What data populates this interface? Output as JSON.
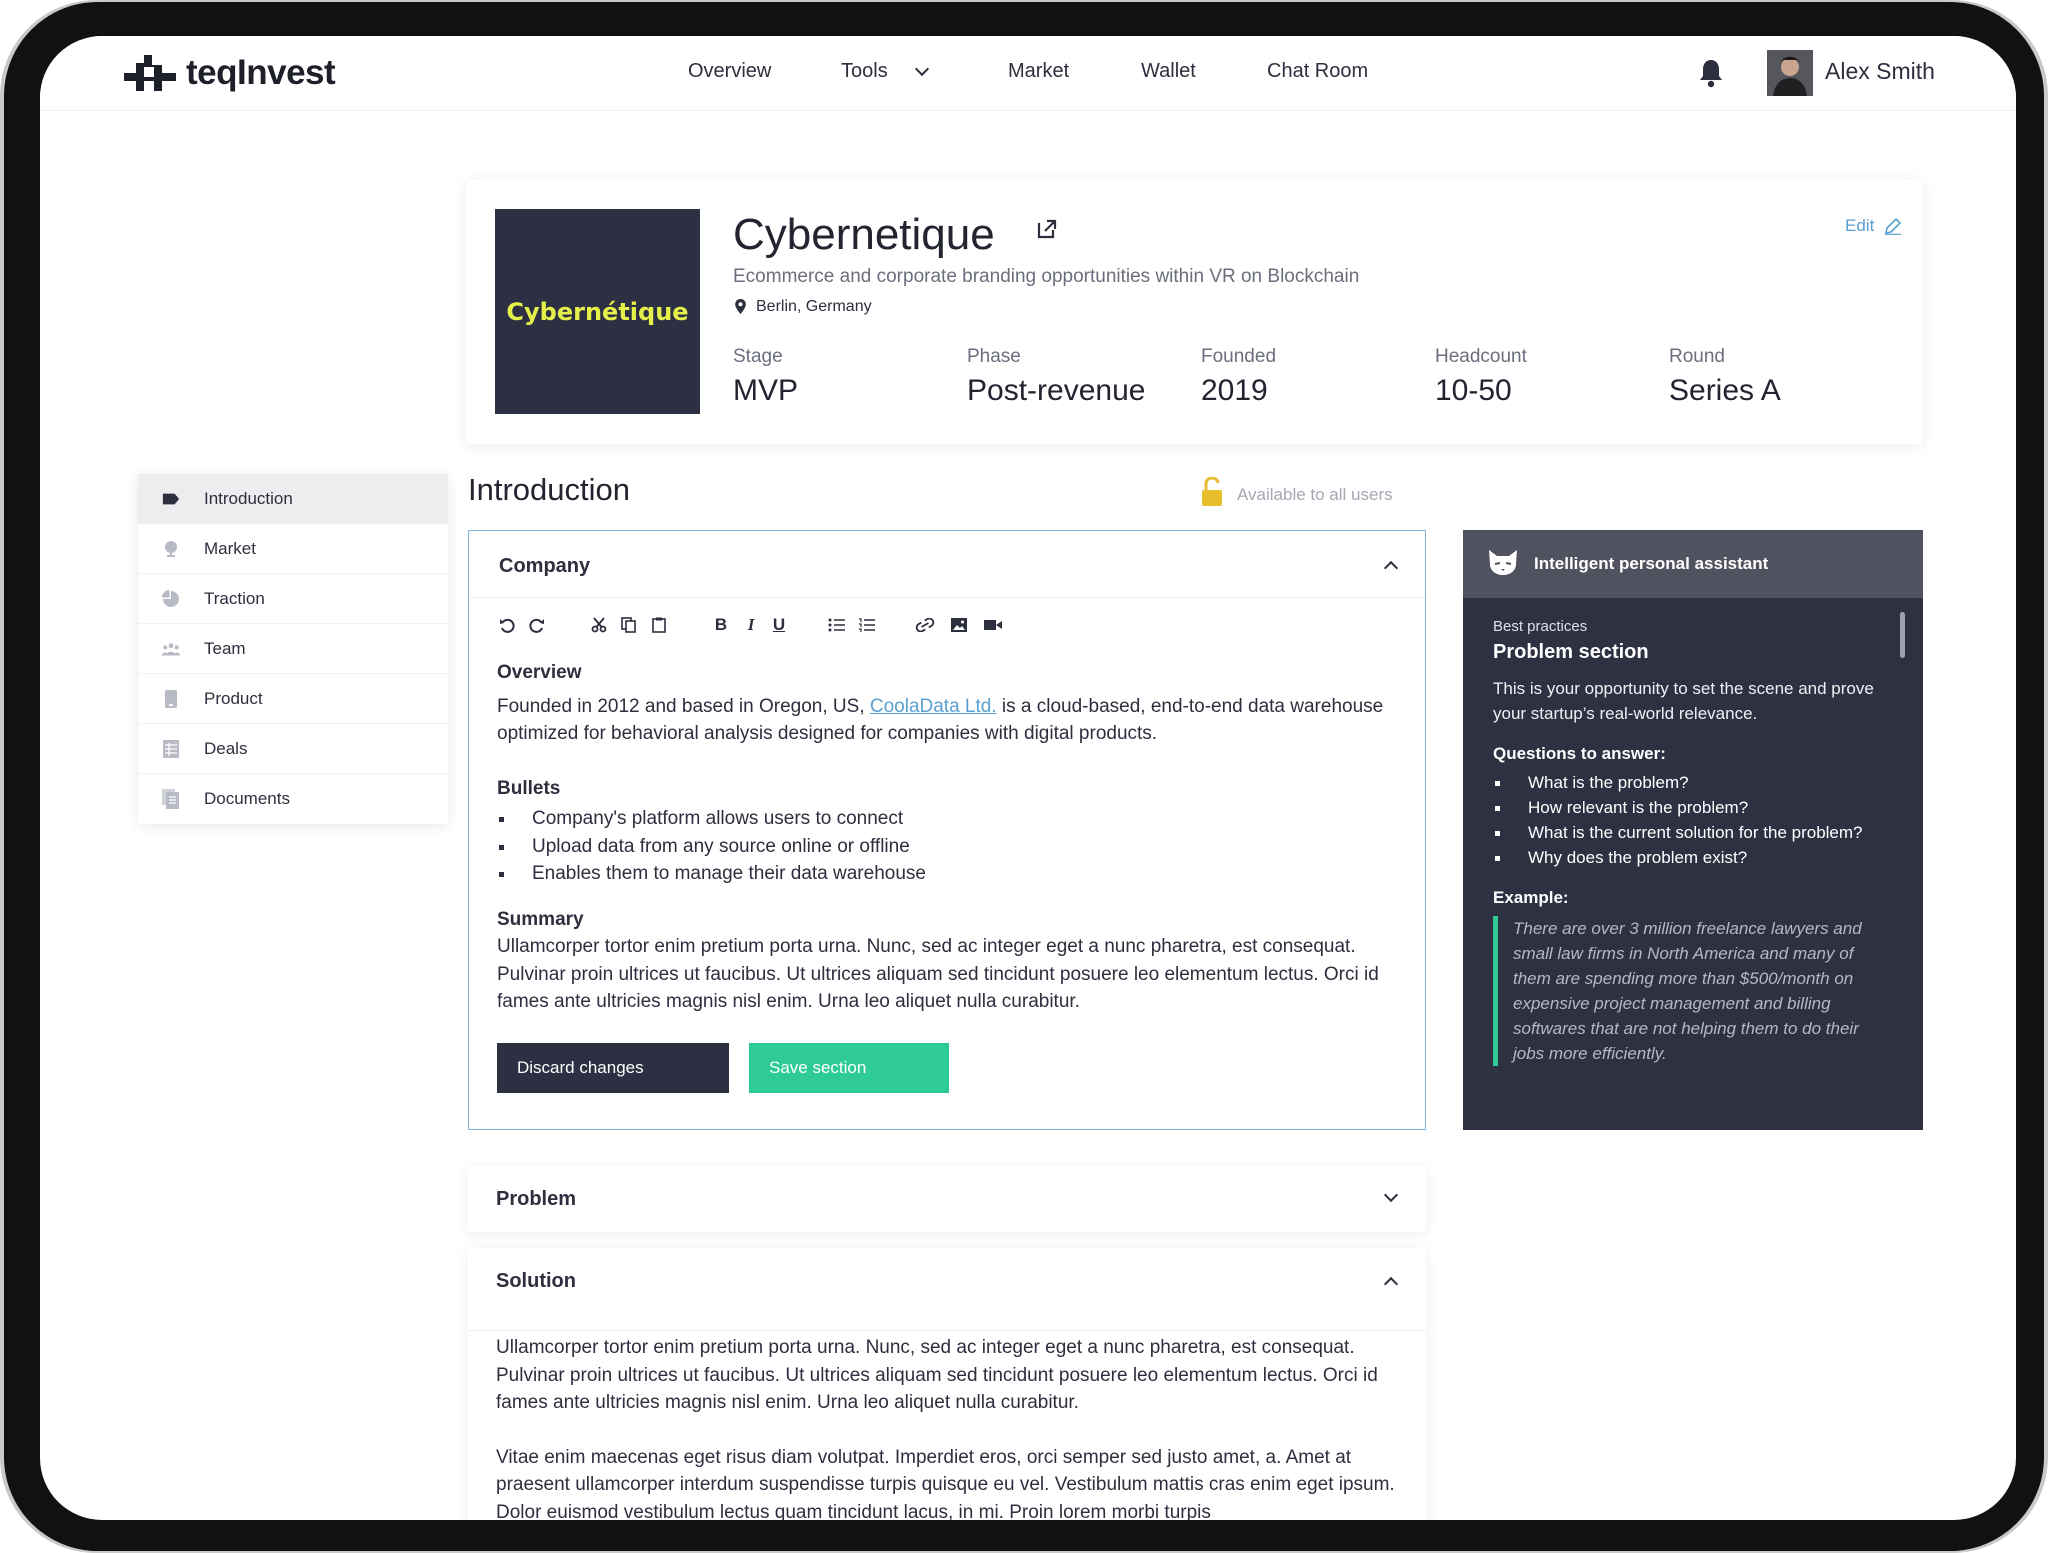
{
  "app": {
    "brand": "teqInvest",
    "nav": [
      {
        "label": "Overview"
      },
      {
        "label": "Tools"
      },
      {
        "label": "Market"
      },
      {
        "label": "Wallet"
      },
      {
        "label": "Chat Room"
      }
    ],
    "user_name": "Alex Smith"
  },
  "company": {
    "logo_text": "Cybernétique",
    "name": "Cybernetique",
    "tagline": "Ecommerce and corporate branding opportunities within VR on Blockchain",
    "location": "Berlin, Germany",
    "edit_label": "Edit",
    "stats": [
      {
        "label": "Stage",
        "value": "MVP"
      },
      {
        "label": "Phase",
        "value": "Post-revenue"
      },
      {
        "label": "Founded",
        "value": "2019"
      },
      {
        "label": "Headcount",
        "value": "10-50"
      },
      {
        "label": "Round",
        "value": "Series A"
      }
    ]
  },
  "sidebar": {
    "items": [
      {
        "label": "Introduction",
        "icon": "tag-icon",
        "active": true
      },
      {
        "label": "Market",
        "icon": "globe-icon"
      },
      {
        "label": "Traction",
        "icon": "pie-chart-icon"
      },
      {
        "label": "Team",
        "icon": "people-icon"
      },
      {
        "label": "Product",
        "icon": "phone-icon"
      },
      {
        "label": "Deals",
        "icon": "table-icon"
      },
      {
        "label": "Documents",
        "icon": "documents-icon"
      }
    ]
  },
  "section": {
    "title": "Introduction",
    "availability": "Available to all users"
  },
  "editor": {
    "card_title": "Company",
    "overview_heading": "Overview",
    "overview_text_before": "Founded in 2012 and based in Oregon, US, ",
    "overview_link": "CoolaData Ltd.",
    "overview_text_after": " is a cloud-based, end-to-end data warehouse optimized for behavioral analysis designed for companies with digital products.",
    "bullets_heading": "Bullets",
    "bullets": [
      "Company's platform allows users to connect",
      "Upload data from any source online or offline",
      "Enables them to manage their data warehouse"
    ],
    "summary_heading": "Summary",
    "summary_text": "Ullamcorper tortor enim pretium porta urna. Nunc, sed ac integer eget a nunc pharetra, est consequat. Pulvinar proin ultrices ut faucibus. Ut ultrices aliquam sed tincidunt posuere leo elementum lectus. Orci id fames ante ultricies magnis nisl enim. Urna leo aliquet nulla curabitur.",
    "discard_label": "Discard changes",
    "save_label": "Save section"
  },
  "problem": {
    "title": "Problem"
  },
  "solution": {
    "title": "Solution",
    "para1": "Ullamcorper tortor enim pretium porta urna. Nunc, sed ac integer eget a nunc pharetra, est consequat. Pulvinar proin ultrices ut faucibus. Ut ultrices aliquam sed tincidunt posuere leo elementum lectus. Orci id fames ante ultricies magnis nisl enim. Urna leo aliquet nulla curabitur.",
    "para2": "Vitae enim maecenas eget risus diam volutpat. Imperdiet eros, orci semper sed justo amet, a. Amet at praesent ullamcorper interdum suspendisse turpis quisque eu vel. Vestibulum mattis cras enim eget ipsum. Dolor euismod vestibulum lectus quam tincidunt lacus, in mi. Proin lorem morbi turpis"
  },
  "assistant": {
    "title": "Intelligent personal assistant",
    "kicker": "Best practices",
    "heading": "Problem section",
    "intro": "This is your opportunity to set the scene and prove your startup’s real-world relevance.",
    "questions_heading": "Questions to answer:",
    "questions": [
      "What is the problem?",
      "How relevant is the problem?",
      "What is the current solution for the problem?",
      "Why does the problem exist?"
    ],
    "example_heading": "Example:",
    "example_text": "There are over 3 million freelance lawyers and small law firms in North America and many of them are spending more than $500/month on expensive project management and billing softwares that are not helping them to do their jobs more efficiently."
  },
  "colors": {
    "accent_green": "#2ecc94",
    "dark_navy": "#2d3042",
    "link_blue": "#5aa0d0",
    "logo_yellow": "#e6f04a"
  }
}
